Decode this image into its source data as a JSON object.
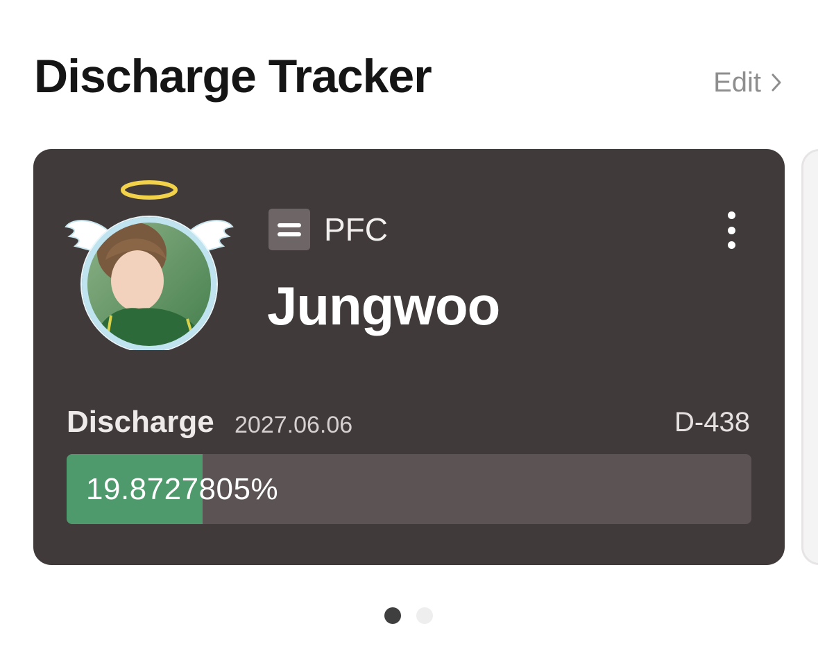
{
  "header": {
    "title": "Discharge Tracker",
    "edit_label": "Edit"
  },
  "card": {
    "group": "PFC",
    "name": "Jungwoo",
    "discharge_label": "Discharge",
    "discharge_date": "2027.06.06",
    "d_day": "D-438",
    "progress_text": "19.8727805%",
    "progress_value": 19.8727805
  },
  "pagination": {
    "total": 2,
    "active_index": 0
  },
  "colors": {
    "card_bg": "#413a3a",
    "progress_fill": "#4f9a6c",
    "progress_track": "#5c5454",
    "avatar_ring": "#bfe4ef",
    "halo": "#f1d24a"
  },
  "icons": {
    "edit_chevron": "chevron-right-icon",
    "group_badge": "equals-badge-icon",
    "more": "more-vertical-icon",
    "halo": "halo-icon",
    "wings": "angel-wings-icon"
  }
}
